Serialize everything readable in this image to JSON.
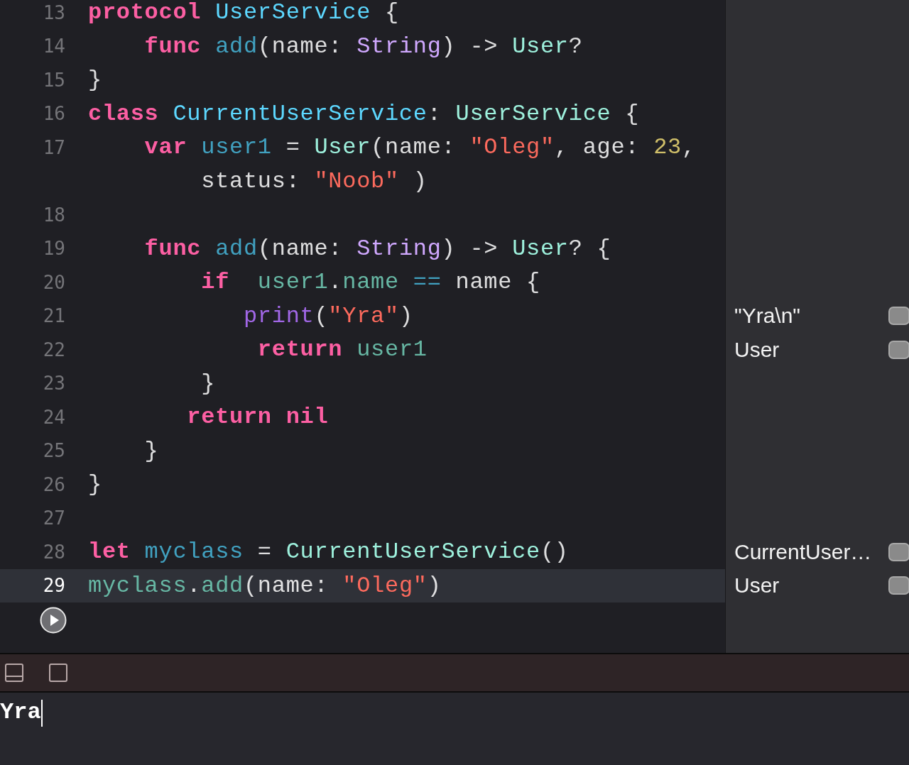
{
  "editor": {
    "lines": [
      {
        "number": "13",
        "selected": false,
        "tokens": [
          {
            "kind": "keyword",
            "text": "protocol"
          },
          {
            "kind": "type-decl",
            "text": " UserService"
          },
          {
            "kind": "plain",
            "text": " {"
          }
        ]
      },
      {
        "number": "14",
        "selected": false,
        "tokens": [
          {
            "kind": "keyword",
            "text": "    func"
          },
          {
            "kind": "other-decl",
            "text": " add"
          },
          {
            "kind": "plain",
            "text": "(name: "
          },
          {
            "kind": "system-type",
            "text": "String"
          },
          {
            "kind": "plain",
            "text": ") -> "
          },
          {
            "kind": "project-type",
            "text": "User"
          },
          {
            "kind": "plain",
            "text": "?"
          }
        ]
      },
      {
        "number": "15",
        "selected": false,
        "tokens": [
          {
            "kind": "plain",
            "text": "}"
          }
        ]
      },
      {
        "number": "16",
        "selected": false,
        "tokens": [
          {
            "kind": "keyword",
            "text": "class"
          },
          {
            "kind": "type-decl",
            "text": " CurrentUserService"
          },
          {
            "kind": "plain",
            "text": ": "
          },
          {
            "kind": "project-type",
            "text": "UserService"
          },
          {
            "kind": "plain",
            "text": " {"
          }
        ]
      },
      {
        "number": "17",
        "selected": false,
        "tokens": [
          {
            "kind": "keyword",
            "text": "    var"
          },
          {
            "kind": "other-decl",
            "text": " user1"
          },
          {
            "kind": "plain",
            "text": " = "
          },
          {
            "kind": "project-type",
            "text": "User"
          },
          {
            "kind": "plain",
            "text": "(name: "
          },
          {
            "kind": "string",
            "text": "\"Oleg\""
          },
          {
            "kind": "plain",
            "text": ", age: "
          },
          {
            "kind": "number",
            "text": "23"
          },
          {
            "kind": "plain",
            "text": ","
          }
        ]
      },
      {
        "selected": false,
        "tokens": [
          {
            "kind": "plain",
            "text": "        status: "
          },
          {
            "kind": "string",
            "text": "\"Noob\""
          },
          {
            "kind": "plain",
            "text": " )"
          }
        ]
      },
      {
        "number": "18",
        "selected": false
      },
      {
        "number": "19",
        "selected": false,
        "tokens": [
          {
            "kind": "keyword",
            "text": "    func"
          },
          {
            "kind": "other-decl",
            "text": " add"
          },
          {
            "kind": "plain",
            "text": "(name: "
          },
          {
            "kind": "system-type",
            "text": "String"
          },
          {
            "kind": "plain",
            "text": ") -> "
          },
          {
            "kind": "project-type",
            "text": "User"
          },
          {
            "kind": "plain",
            "text": "? {"
          }
        ]
      },
      {
        "number": "20",
        "selected": false,
        "tokens": [
          {
            "kind": "keyword",
            "text": "        if"
          },
          {
            "kind": "project-member",
            "text": "  user1"
          },
          {
            "kind": "plain",
            "text": "."
          },
          {
            "kind": "project-member",
            "text": "name"
          },
          {
            "kind": "operator",
            "text": " =="
          },
          {
            "kind": "plain",
            "text": " name {"
          }
        ]
      },
      {
        "number": "21",
        "selected": false,
        "tokens": [
          {
            "kind": "system-function",
            "text": "           print"
          },
          {
            "kind": "plain",
            "text": "("
          },
          {
            "kind": "string",
            "text": "\"Yra\""
          },
          {
            "kind": "plain",
            "text": ")"
          }
        ],
        "result": "\"Yra\\n\""
      },
      {
        "number": "22",
        "selected": false,
        "tokens": [
          {
            "kind": "keyword",
            "text": "            return"
          },
          {
            "kind": "project-member",
            "text": " user1"
          }
        ],
        "result": "User"
      },
      {
        "number": "23",
        "selected": false,
        "tokens": [
          {
            "kind": "plain",
            "text": "        }"
          }
        ]
      },
      {
        "number": "24",
        "selected": false,
        "tokens": [
          {
            "kind": "keyword",
            "text": "       return nil"
          }
        ]
      },
      {
        "number": "25",
        "selected": false,
        "tokens": [
          {
            "kind": "plain",
            "text": "    }"
          }
        ]
      },
      {
        "number": "26",
        "selected": false,
        "tokens": [
          {
            "kind": "plain",
            "text": "}"
          }
        ]
      },
      {
        "number": "27",
        "selected": false
      },
      {
        "number": "28",
        "selected": false,
        "tokens": [
          {
            "kind": "keyword",
            "text": "let"
          },
          {
            "kind": "other-decl",
            "text": " myclass"
          },
          {
            "kind": "plain",
            "text": " = "
          },
          {
            "kind": "project-type",
            "text": "CurrentUserService"
          },
          {
            "kind": "plain",
            "text": "()"
          }
        ],
        "result": "CurrentUser…"
      },
      {
        "number": "29",
        "selected": true,
        "tokens": [
          {
            "kind": "project-member",
            "text": "myclass"
          },
          {
            "kind": "plain",
            "text": "."
          },
          {
            "kind": "project-member",
            "text": "add"
          },
          {
            "kind": "plain",
            "text": "(name: "
          },
          {
            "kind": "string",
            "text": "\"Oleg\""
          },
          {
            "kind": "plain",
            "text": ")"
          }
        ],
        "result": "User"
      }
    ]
  },
  "console": {
    "output": "Yra"
  }
}
